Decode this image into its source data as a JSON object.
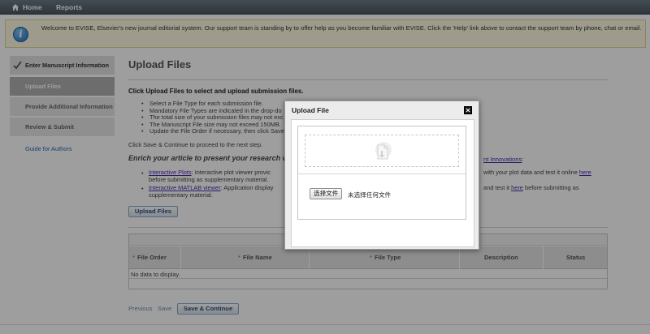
{
  "nav": {
    "home": "Home",
    "reports": "Reports"
  },
  "banner": {
    "text": "Welcome to EVISE, Elsevier's new journal editorial system. Our support team is standing by to offer help as you become familiar with EVISE. Click the 'Help' link above to contact the support team by phone, chat or email."
  },
  "sidebar": {
    "items": [
      {
        "label": "Enter Manuscript Information"
      },
      {
        "label": "Upload Files"
      },
      {
        "label": "Provide Additional Information"
      },
      {
        "label": "Review & Submit"
      }
    ],
    "guide_link": "Guide for Authors"
  },
  "main": {
    "title": "Upload Files",
    "lead": "Click Upload Files to select and upload submission files.",
    "bullets": [
      "Select a File Type for each submission file.",
      "Mandatory File Types are indicated in the drop-do",
      "The total size of your submission files may not exc",
      "The Manuscript File size may not exceed 150MB.",
      "Update the File Order if necessary, then click Save"
    ],
    "proceed": "Click Save & Continue to proceed to the next step.",
    "enrich_heading": "Enrich your article to present your research w",
    "enrich_link": "nt Innovations",
    "enrich_tail": ":",
    "features": [
      {
        "link": "Interactive Plots",
        "line1": ": Interactive plot viewer provic",
        "line1_right": "with your plot data and test it online",
        "line1_link": "here",
        "line2": "before submitting as supplementary material."
      },
      {
        "link": "Interactive MATLAB viewer",
        "line1": ": Application display",
        "line1_right": "and test it",
        "line1_link": "here",
        "line1_tail": "before submitting as",
        "line2": "supplementary material."
      }
    ],
    "upload_button": "Upload Files"
  },
  "grid": {
    "columns": [
      {
        "label": "File Order",
        "required": true
      },
      {
        "label": "File Name",
        "required": true
      },
      {
        "label": "File Type",
        "required": true
      },
      {
        "label": "Description",
        "required": false
      },
      {
        "label": "Status",
        "required": false
      }
    ],
    "required_marker": "*",
    "empty_text": "No data to display."
  },
  "footer": {
    "previous": "Previous",
    "save": "Save",
    "save_continue": "Save & Continue"
  },
  "modal": {
    "title": "Upload File",
    "choose_button": "选择文件",
    "no_file": "未选择任何文件"
  },
  "colors": {
    "link": "#4b2aa8",
    "nav": "#5a6772",
    "banner_bg": "#fffbe3",
    "active_step": "#b0b0b0"
  },
  "icons": [
    "home-icon",
    "info-icon",
    "check-icon",
    "close-icon",
    "upload-icon"
  ]
}
